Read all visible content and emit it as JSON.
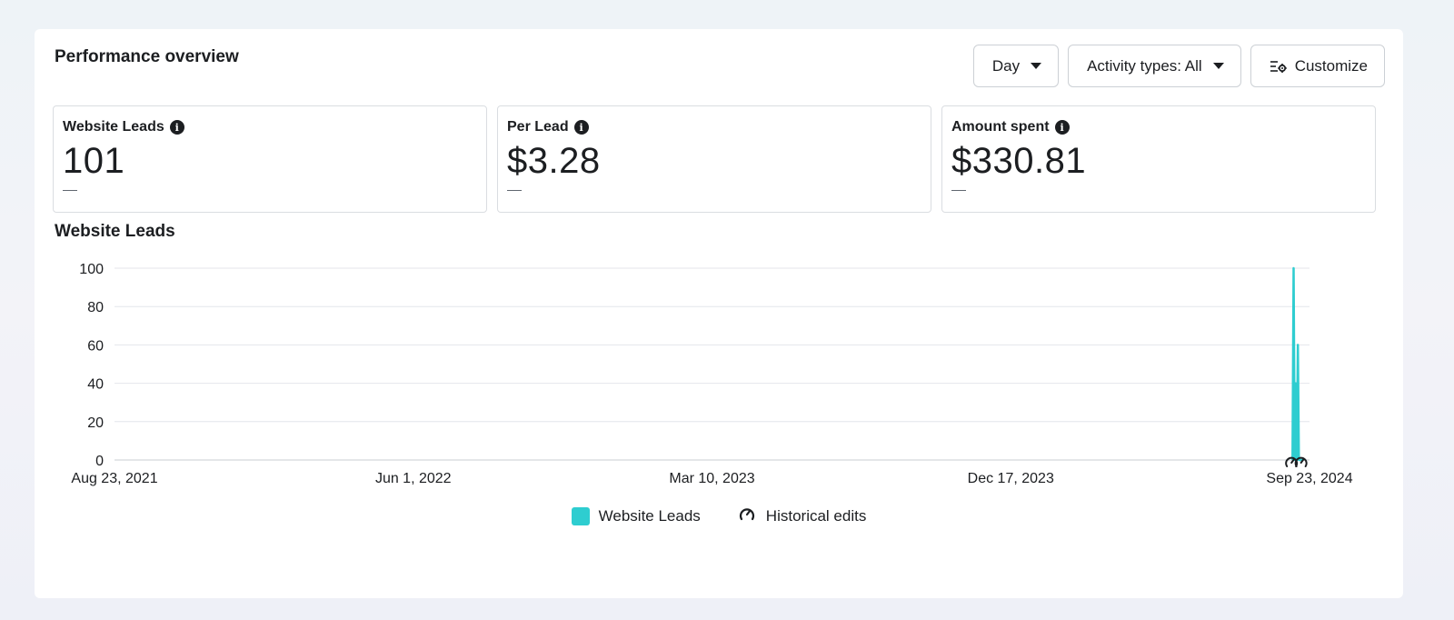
{
  "card": {
    "title": "Performance overview"
  },
  "toolbar": {
    "day_label": "Day",
    "activity_label": "Activity types: All",
    "customize_label": "Customize"
  },
  "metrics": [
    {
      "label": "Website Leads",
      "value": "101",
      "delta": "—"
    },
    {
      "label": "Per Lead",
      "value": "$3.28",
      "delta": "—"
    },
    {
      "label": "Amount spent",
      "value": "$330.81",
      "delta": "—"
    }
  ],
  "chart": {
    "title": "Website Leads"
  },
  "legend": {
    "series_label": "Website Leads",
    "edits_label": "Historical edits"
  },
  "colors": {
    "series": "#2ecdd0",
    "grid": "#e4e6eb",
    "text": "#1c1e21"
  },
  "chart_data": {
    "type": "line",
    "title": "Website Leads",
    "xlabel": "",
    "ylabel": "",
    "ylim": [
      0,
      100
    ],
    "yticks": [
      0,
      20,
      40,
      60,
      80,
      100
    ],
    "xlim": [
      "2021-08-23",
      "2024-09-23"
    ],
    "xticks": [
      "Aug 23, 2021",
      "Jun 1, 2022",
      "Mar 10, 2023",
      "Dec 17, 2023",
      "Sep 23, 2024"
    ],
    "grid": true,
    "legend": "bottom-center",
    "series": [
      {
        "name": "Website Leads",
        "x": [
          "2024-09-07",
          "2024-09-08",
          "2024-09-09",
          "2024-09-10",
          "2024-09-11",
          "2024-09-12",
          "2024-09-13",
          "2024-09-14",
          "2024-09-15",
          "2024-09-16",
          "2024-09-17"
        ],
        "values": [
          0,
          100,
          0,
          40,
          0,
          60,
          0,
          0,
          0,
          0,
          0
        ]
      }
    ],
    "historical_edits": [
      "2024-09-06",
      "2024-09-15"
    ]
  }
}
